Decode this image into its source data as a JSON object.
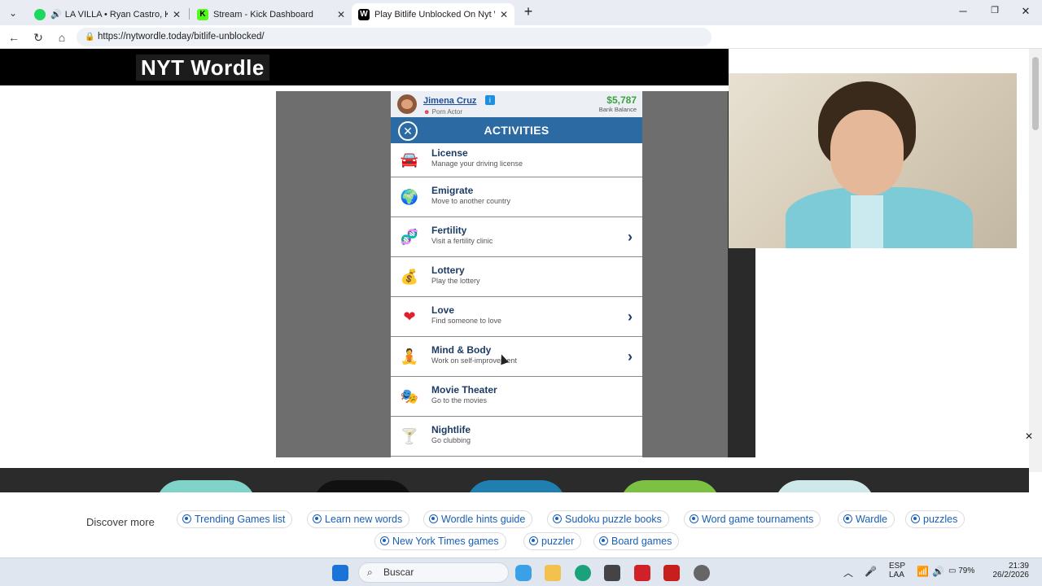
{
  "browser": {
    "tabs": [
      {
        "label": "LA VILLA • Ryan Castro, Kapo",
        "favicon_color": "#1ed760",
        "active": false
      },
      {
        "label": "Stream - Kick Dashboard",
        "favicon_color": "#53fc18",
        "active": false
      },
      {
        "label": "Play Bitlife Unblocked On Nyt Wo",
        "favicon_color": "#000000",
        "active": true
      }
    ],
    "url": "https://nytwordle.today/bitlife-unblocked/"
  },
  "site": {
    "logo": "NYT Wordle"
  },
  "game": {
    "character": {
      "name": "Jimena Cruz",
      "occupation": "Porn Actor",
      "balance": "$5,787",
      "balance_label": "Bank Balance"
    },
    "screen_title": "ACTIVITIES",
    "activities": [
      {
        "name": "License",
        "desc": "Manage your driving license",
        "icon": "car-icon",
        "glyph": "🚘",
        "has_chevron": false
      },
      {
        "name": "Emigrate",
        "desc": "Move to another country",
        "icon": "globe-icon",
        "glyph": "🌍",
        "has_chevron": false
      },
      {
        "name": "Fertility",
        "desc": "Visit a fertility clinic",
        "icon": "dna-icon",
        "glyph": "🧬",
        "has_chevron": true
      },
      {
        "name": "Lottery",
        "desc": "Play the lottery",
        "icon": "money-bag-icon",
        "glyph": "💰",
        "has_chevron": false
      },
      {
        "name": "Love",
        "desc": "Find someone to love",
        "icon": "heart-icon",
        "glyph": "❤",
        "has_chevron": true
      },
      {
        "name": "Mind & Body",
        "desc": "Work on self-improvement",
        "icon": "meditation-icon",
        "glyph": "🧘",
        "has_chevron": true
      },
      {
        "name": "Movie Theater",
        "desc": "Go to the movies",
        "icon": "theater-masks-icon",
        "glyph": "🎭",
        "has_chevron": false
      },
      {
        "name": "Nightlife",
        "desc": "Go clubbing",
        "icon": "cocktail-icon",
        "glyph": "🍸",
        "has_chevron": false
      }
    ]
  },
  "discover": {
    "label": "Discover more",
    "chips": [
      "Trending Games list",
      "Learn new words",
      "Wordle hints guide",
      "Sudoku puzzle books",
      "Word game tournaments",
      "Wardle",
      "puzzles",
      "New York Times games",
      "puzzler",
      "Board games"
    ]
  },
  "taskbar": {
    "search_placeholder": "Buscar",
    "lang_top": "ESP",
    "lang_bottom": "LAA",
    "battery": "79%",
    "time": "21:39",
    "date": "26/2/2026"
  },
  "colors": {
    "bitlife_header": "#2c6aa3",
    "money_green": "#3aa341",
    "link_blue": "#1a5fb4"
  }
}
